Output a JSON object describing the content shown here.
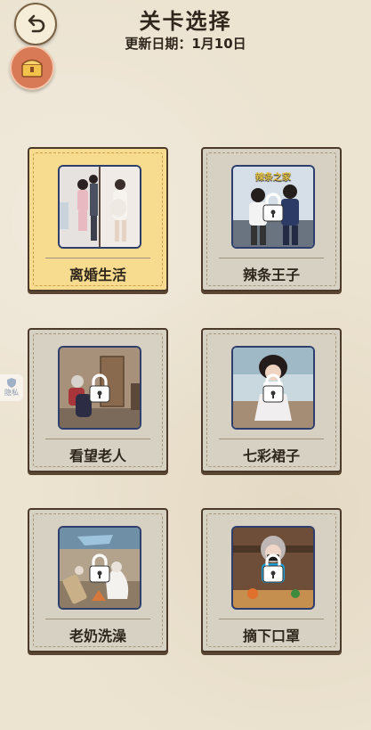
{
  "header": {
    "title": "关卡选择",
    "update_label": "更新日期：1月10日"
  },
  "side_tab": {
    "label": "隐私"
  },
  "levels": [
    {
      "label": "离婚生活",
      "locked": false,
      "selected": true
    },
    {
      "label": "辣条王子",
      "locked": true,
      "selected": false,
      "thumb_caption": "辣条之家"
    },
    {
      "label": "看望老人",
      "locked": true,
      "selected": false
    },
    {
      "label": "七彩裙子",
      "locked": true,
      "selected": false
    },
    {
      "label": "老奶洗澡",
      "locked": true,
      "selected": false
    },
    {
      "label": "摘下口罩",
      "locked": true,
      "selected": false
    }
  ],
  "colors": {
    "background": "#ece3d1",
    "card_locked": "#d7d1c3",
    "card_selected": "#f7dc90",
    "card_border": "#4b3a2a"
  }
}
